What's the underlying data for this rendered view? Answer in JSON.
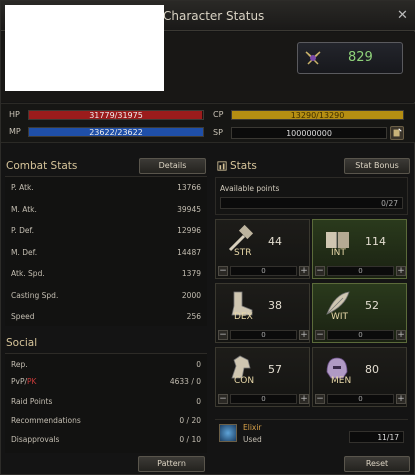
{
  "window": {
    "title": "Character Status",
    "close_label": "✕"
  },
  "header": {
    "combat_power": "829",
    "emblem_icon": "crossed-swords-emblem-icon"
  },
  "vitals": {
    "hp": {
      "label": "HP",
      "text": "31779/31975",
      "fraction": 0.9939,
      "color": "#9b1c1c"
    },
    "mp": {
      "label": "MP",
      "text": "23622/23622",
      "fraction": 1.0,
      "color": "#1f4fa8"
    },
    "cp": {
      "label": "CP",
      "text": "13290/13290",
      "fraction": 1.0,
      "color": "#b58e12"
    },
    "sp": {
      "label": "SP",
      "value": "100000000"
    }
  },
  "combat": {
    "title": "Combat Stats",
    "details_label": "Details",
    "rows": [
      {
        "k": "P. Atk.",
        "v": "13766"
      },
      {
        "k": "M. Atk.",
        "v": "39945"
      },
      {
        "k": "P. Def.",
        "v": "12996"
      },
      {
        "k": "M. Def.",
        "v": "14487"
      },
      {
        "k": "Atk. Spd.",
        "v": "1379"
      },
      {
        "k": "Casting Spd.",
        "v": "2000"
      },
      {
        "k": "Speed",
        "v": "256"
      }
    ]
  },
  "social": {
    "title": "Social",
    "rep": {
      "k": "Rep.",
      "v": "0"
    },
    "pvp": {
      "k1": "PvP/",
      "k2": "PK",
      "v": "4633 / 0"
    },
    "raid": {
      "k": "Raid Points",
      "v": "0"
    },
    "rec": {
      "k": "Recommendations",
      "v": "0 / 20"
    },
    "dis": {
      "k": "Disapprovals",
      "v": "0 / 10"
    }
  },
  "stats": {
    "title": "Stats",
    "bonus_label": "Stat Bonus",
    "available_label": "Available points",
    "available_value": "0/27",
    "items": [
      {
        "ab": "STR",
        "val": "44",
        "inc": "0",
        "highlight": false,
        "icon": "hammer-icon"
      },
      {
        "ab": "INT",
        "val": "114",
        "inc": "0",
        "highlight": true,
        "icon": "book-icon"
      },
      {
        "ab": "DEX",
        "val": "38",
        "inc": "0",
        "highlight": false,
        "icon": "boot-icon"
      },
      {
        "ab": "WIT",
        "val": "52",
        "inc": "0",
        "highlight": true,
        "icon": "feather-icon"
      },
      {
        "ab": "CON",
        "val": "57",
        "inc": "0",
        "highlight": false,
        "icon": "horse-icon"
      },
      {
        "ab": "MEN",
        "val": "80",
        "inc": "0",
        "highlight": false,
        "icon": "helmet-icon"
      }
    ],
    "minus": "−",
    "plus": "+"
  },
  "elixir": {
    "name": "Elixir",
    "used_label": "Used",
    "count": "11/17"
  },
  "footer": {
    "pattern_label": "Pattern",
    "reset_label": "Reset"
  }
}
